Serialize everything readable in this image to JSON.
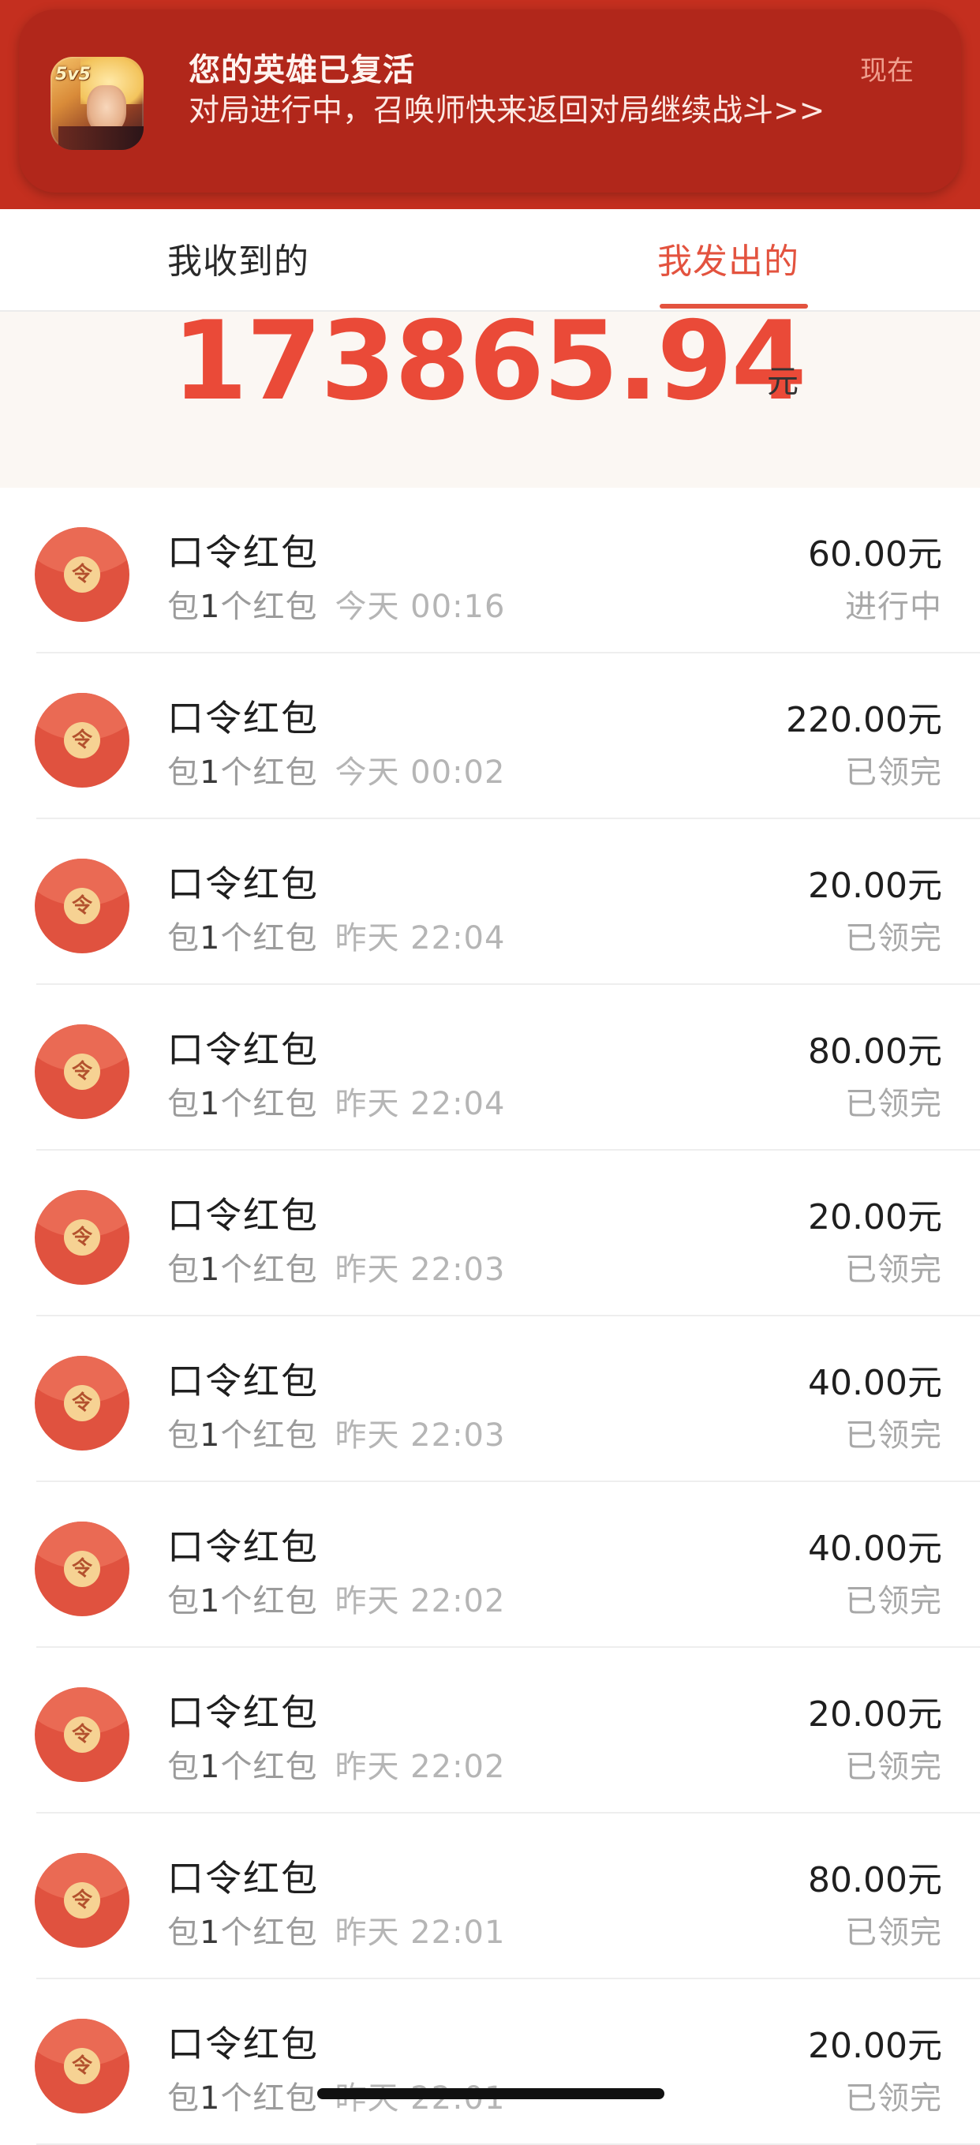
{
  "notification": {
    "title": "您的英雄已复活",
    "time": "现在",
    "body": "对局进行中，召唤师快来返回对局继续战斗>>",
    "app_badge": "5v5"
  },
  "tabs": {
    "received": "我收到的",
    "sent": "我发出的",
    "active": "sent"
  },
  "summary": {
    "total": "173865.94",
    "unit": "元"
  },
  "envelope_seal_char": "令",
  "list": [
    {
      "title": "口令红包",
      "prefix": "包",
      "count": "1",
      "suffix": "个红包",
      "time": "今天 00:16",
      "amount": "60.00元",
      "status": "进行中"
    },
    {
      "title": "口令红包",
      "prefix": "包",
      "count": "1",
      "suffix": "个红包",
      "time": "今天 00:02",
      "amount": "220.00元",
      "status": "已领完"
    },
    {
      "title": "口令红包",
      "prefix": "包",
      "count": "1",
      "suffix": "个红包",
      "time": "昨天 22:04",
      "amount": "20.00元",
      "status": "已领完"
    },
    {
      "title": "口令红包",
      "prefix": "包",
      "count": "1",
      "suffix": "个红包",
      "time": "昨天 22:04",
      "amount": "80.00元",
      "status": "已领完"
    },
    {
      "title": "口令红包",
      "prefix": "包",
      "count": "1",
      "suffix": "个红包",
      "time": "昨天 22:03",
      "amount": "20.00元",
      "status": "已领完"
    },
    {
      "title": "口令红包",
      "prefix": "包",
      "count": "1",
      "suffix": "个红包",
      "time": "昨天 22:03",
      "amount": "40.00元",
      "status": "已领完"
    },
    {
      "title": "口令红包",
      "prefix": "包",
      "count": "1",
      "suffix": "个红包",
      "time": "昨天 22:02",
      "amount": "40.00元",
      "status": "已领完"
    },
    {
      "title": "口令红包",
      "prefix": "包",
      "count": "1",
      "suffix": "个红包",
      "time": "昨天 22:02",
      "amount": "20.00元",
      "status": "已领完"
    },
    {
      "title": "口令红包",
      "prefix": "包",
      "count": "1",
      "suffix": "个红包",
      "time": "昨天 22:01",
      "amount": "80.00元",
      "status": "已领完"
    },
    {
      "title": "口令红包",
      "prefix": "包",
      "count": "1",
      "suffix": "个红包",
      "time": "昨天 22:01",
      "amount": "20.00元",
      "status": "已领完"
    }
  ],
  "colors": {
    "accent": "#e3533f",
    "notification_bg": "#b1271b",
    "envelope": "#e0523f",
    "seal": "#f6d293"
  }
}
